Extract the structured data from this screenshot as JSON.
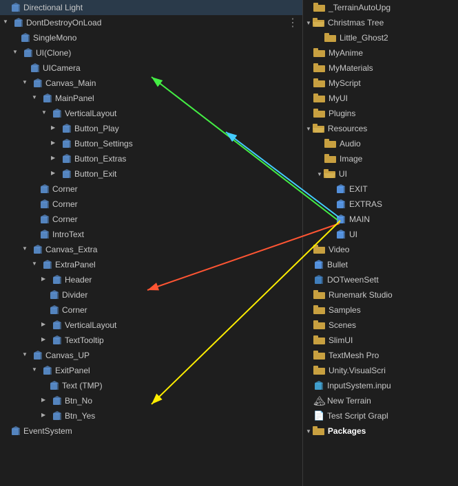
{
  "left": {
    "items": [
      {
        "id": "directional-light",
        "indent": 0,
        "label": "Directional Light",
        "arrow": "none",
        "icon": "cube"
      },
      {
        "id": "dont-destroy",
        "indent": 0,
        "label": "DontDestroyOnLoad",
        "arrow": "down",
        "icon": "cube",
        "dot": true
      },
      {
        "id": "single-mono",
        "indent": 1,
        "label": "SingleMono",
        "arrow": "none",
        "icon": "cube"
      },
      {
        "id": "ui-clone",
        "indent": 1,
        "label": "UI(Clone)",
        "arrow": "down",
        "icon": "cube"
      },
      {
        "id": "ui-camera",
        "indent": 2,
        "label": "UICamera",
        "arrow": "none",
        "icon": "cube"
      },
      {
        "id": "canvas-main",
        "indent": 2,
        "label": "Canvas_Main",
        "arrow": "down",
        "icon": "cube"
      },
      {
        "id": "main-panel",
        "indent": 3,
        "label": "MainPanel",
        "arrow": "down",
        "icon": "cube"
      },
      {
        "id": "vertical-layout",
        "indent": 4,
        "label": "VerticalLayout",
        "arrow": "down",
        "icon": "cube"
      },
      {
        "id": "button-play",
        "indent": 5,
        "label": "Button_Play",
        "arrow": "right",
        "icon": "cube"
      },
      {
        "id": "button-settings",
        "indent": 5,
        "label": "Button_Settings",
        "arrow": "right",
        "icon": "cube"
      },
      {
        "id": "button-extras",
        "indent": 5,
        "label": "Button_Extras",
        "arrow": "right",
        "icon": "cube"
      },
      {
        "id": "button-exit",
        "indent": 5,
        "label": "Button_Exit",
        "arrow": "right",
        "icon": "cube"
      },
      {
        "id": "corner-1",
        "indent": 3,
        "label": "Corner",
        "arrow": "none",
        "icon": "cube"
      },
      {
        "id": "corner-2",
        "indent": 3,
        "label": "Corner",
        "arrow": "none",
        "icon": "cube"
      },
      {
        "id": "corner-3",
        "indent": 3,
        "label": "Corner",
        "arrow": "none",
        "icon": "cube"
      },
      {
        "id": "intro-text",
        "indent": 3,
        "label": "IntroText",
        "arrow": "none",
        "icon": "cube"
      },
      {
        "id": "canvas-extra",
        "indent": 2,
        "label": "Canvas_Extra",
        "arrow": "down",
        "icon": "cube"
      },
      {
        "id": "extra-panel",
        "indent": 3,
        "label": "ExtraPanel",
        "arrow": "down",
        "icon": "cube"
      },
      {
        "id": "header",
        "indent": 4,
        "label": "Header",
        "arrow": "right",
        "icon": "cube"
      },
      {
        "id": "divider",
        "indent": 4,
        "label": "Divider",
        "arrow": "none",
        "icon": "cube"
      },
      {
        "id": "corner-4",
        "indent": 4,
        "label": "Corner",
        "arrow": "none",
        "icon": "cube"
      },
      {
        "id": "vertical-layout2",
        "indent": 4,
        "label": "VerticalLayout",
        "arrow": "right",
        "icon": "cube"
      },
      {
        "id": "text-tooltip",
        "indent": 4,
        "label": "TextTooltip",
        "arrow": "right",
        "icon": "cube"
      },
      {
        "id": "canvas-up",
        "indent": 2,
        "label": "Canvas_UP",
        "arrow": "down",
        "icon": "cube"
      },
      {
        "id": "exit-panel",
        "indent": 3,
        "label": "ExitPanel",
        "arrow": "down",
        "icon": "cube"
      },
      {
        "id": "text-tmp",
        "indent": 4,
        "label": "Text (TMP)",
        "arrow": "none",
        "icon": "cube"
      },
      {
        "id": "btn-no",
        "indent": 4,
        "label": "Btn_No",
        "arrow": "right",
        "icon": "cube"
      },
      {
        "id": "btn-yes",
        "indent": 4,
        "label": "Btn_Yes",
        "arrow": "right",
        "icon": "cube"
      },
      {
        "id": "event-system",
        "indent": 0,
        "label": "EventSystem",
        "arrow": "none",
        "icon": "cube"
      }
    ]
  },
  "right": {
    "items": [
      {
        "id": "terrain-auto",
        "indent": 0,
        "label": "_TerrainAutoUpg",
        "arrow": "none",
        "icon": "folder"
      },
      {
        "id": "christmas-tree",
        "indent": 0,
        "label": "Christmas Tree",
        "arrow": "down",
        "icon": "folder-open"
      },
      {
        "id": "little-ghost",
        "indent": 1,
        "label": "Little_Ghost2",
        "arrow": "none",
        "icon": "folder"
      },
      {
        "id": "my-anime",
        "indent": 0,
        "label": "MyAnime",
        "arrow": "none",
        "icon": "folder"
      },
      {
        "id": "my-materials",
        "indent": 0,
        "label": "MyMaterials",
        "arrow": "none",
        "icon": "folder"
      },
      {
        "id": "my-script",
        "indent": 0,
        "label": "MyScript",
        "arrow": "none",
        "icon": "folder"
      },
      {
        "id": "my-ui",
        "indent": 0,
        "label": "MyUI",
        "arrow": "none",
        "icon": "folder"
      },
      {
        "id": "plugins",
        "indent": 0,
        "label": "Plugins",
        "arrow": "none",
        "icon": "folder"
      },
      {
        "id": "resources",
        "indent": 0,
        "label": "Resources",
        "arrow": "down",
        "icon": "folder-open"
      },
      {
        "id": "audio",
        "indent": 1,
        "label": "Audio",
        "arrow": "none",
        "icon": "folder"
      },
      {
        "id": "image",
        "indent": 1,
        "label": "Image",
        "arrow": "none",
        "icon": "folder"
      },
      {
        "id": "ui-folder",
        "indent": 1,
        "label": "UI",
        "arrow": "down",
        "icon": "folder-open"
      },
      {
        "id": "exit-item",
        "indent": 2,
        "label": "EXIT",
        "arrow": "none",
        "icon": "blue-cube"
      },
      {
        "id": "extras-item",
        "indent": 2,
        "label": "EXTRAS",
        "arrow": "none",
        "icon": "blue-cube"
      },
      {
        "id": "main-item",
        "indent": 2,
        "label": "MAIN",
        "arrow": "none",
        "icon": "blue-cube"
      },
      {
        "id": "ui-item",
        "indent": 2,
        "label": "UI",
        "arrow": "none",
        "icon": "blue-cube"
      },
      {
        "id": "video",
        "indent": 0,
        "label": "Video",
        "arrow": "none",
        "icon": "folder"
      },
      {
        "id": "bullet",
        "indent": 0,
        "label": "Bullet",
        "arrow": "none",
        "icon": "blue-cube"
      },
      {
        "id": "dotween",
        "indent": 0,
        "label": "DOTweenSett",
        "arrow": "none",
        "icon": "blue-cube2"
      },
      {
        "id": "runemark",
        "indent": 0,
        "label": "Runemark Studio",
        "arrow": "none",
        "icon": "folder"
      },
      {
        "id": "samples",
        "indent": 0,
        "label": "Samples",
        "arrow": "none",
        "icon": "folder"
      },
      {
        "id": "scenes",
        "indent": 0,
        "label": "Scenes",
        "arrow": "none",
        "icon": "folder"
      },
      {
        "id": "slim-ui",
        "indent": 0,
        "label": "SlimUI",
        "arrow": "none",
        "icon": "folder"
      },
      {
        "id": "textmesh",
        "indent": 0,
        "label": "TextMesh Pro",
        "arrow": "none",
        "icon": "folder"
      },
      {
        "id": "visual-script",
        "indent": 0,
        "label": "Unity.VisualScri",
        "arrow": "none",
        "icon": "folder"
      },
      {
        "id": "input-system",
        "indent": 0,
        "label": "InputSystem.inpu",
        "arrow": "none",
        "icon": "blue-cube3"
      },
      {
        "id": "new-terrain",
        "indent": 0,
        "label": "New Terrain",
        "arrow": "none",
        "icon": "terrain"
      },
      {
        "id": "test-script",
        "indent": 0,
        "label": "Test Script Grapl",
        "arrow": "none",
        "icon": "script"
      },
      {
        "id": "packages",
        "indent": 0,
        "label": "Packages",
        "arrow": "down",
        "icon": "folder",
        "bold": true
      }
    ]
  },
  "arrows": {
    "green": {
      "color": "#44ee44"
    },
    "cyan": {
      "color": "#44ccff"
    },
    "red": {
      "color": "#ff5533"
    },
    "yellow": {
      "color": "#ffee00"
    }
  }
}
